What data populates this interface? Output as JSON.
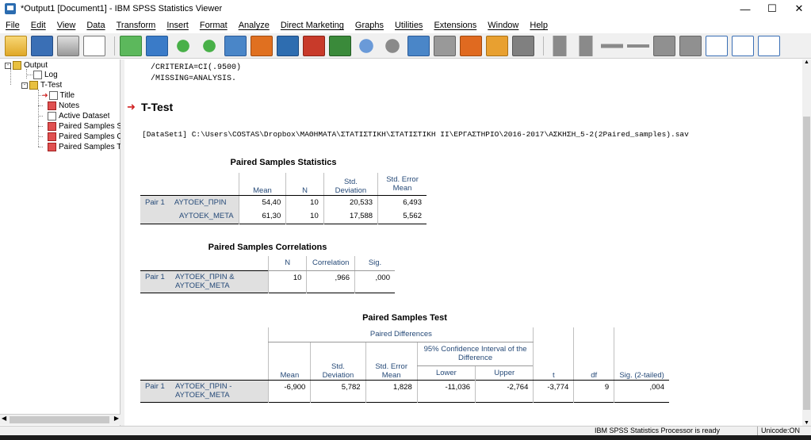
{
  "window": {
    "title": "*Output1 [Document1] - IBM SPSS Statistics Viewer",
    "minimize": "—",
    "maximize": "☐",
    "close": "✕"
  },
  "menu": [
    "File",
    "Edit",
    "View",
    "Data",
    "Transform",
    "Insert",
    "Format",
    "Analyze",
    "Direct Marketing",
    "Graphs",
    "Utilities",
    "Extensions",
    "Window",
    "Help"
  ],
  "toolbar": {
    "icons": [
      "open-icon",
      "save-icon",
      "print-icon",
      "print-preview-icon",
      "export-icon",
      "recall-dialog-icon",
      "undo-icon",
      "redo-icon",
      "goto-data-icon",
      "goto-case-icon",
      "variables-icon",
      "designate-window-icon",
      "insert-output-icon",
      "show-all-icon",
      "collapse-icon",
      "hide-icon",
      "insert-heading-icon",
      "insert-title-icon",
      "insert-text-icon",
      "export-chart-icon",
      "navigate-back-icon",
      "navigate-forward-icon",
      "expand-icon",
      "collapse-minus-icon",
      "promote-icon",
      "demote-icon",
      "show-output-icon",
      "copy-icon",
      "paste-icon"
    ]
  },
  "tree": {
    "output": "Output",
    "log": "Log",
    "ttest": "T-Test",
    "title": "Title",
    "notes": "Notes",
    "active_dataset": "Active Dataset",
    "pss": "Paired Samples S",
    "psc": "Paired Samples C",
    "pst": "Paired Samples T"
  },
  "viewer": {
    "syntax_line1": "/CRITERIA=CI(.9500)",
    "syntax_line2": "/MISSING=ANALYSIS.",
    "heading": "T-Test",
    "dataset": "[DataSet1] C:\\Users\\COSTAS\\Dropbox\\ΜΑΘΗΜΑΤΑ\\ΣΤΑΤΙΣΤΙΚΗ\\ΣΤΑΤΙΣΤΙΚΗ ΙΙ\\ΕΡΓΑΣΤΗΡΙΟ\\2016-2017\\ΑΣΚΗΣΗ_5-2(2Paired_samples).sav"
  },
  "stats": {
    "caption": "Paired Samples Statistics",
    "h_mean": "Mean",
    "h_n": "N",
    "h_sd": "Std. Deviation",
    "h_se": "Std. Error Mean",
    "pair": "Pair 1",
    "r1": {
      "label": "ΑΥΤΟΕΚ_ΠΡΙΝ",
      "mean": "54,40",
      "n": "10",
      "sd": "20,533",
      "se": "6,493"
    },
    "r2": {
      "label": "ΑΥΤΟΕΚ_ΜΕΤΑ",
      "mean": "61,30",
      "n": "10",
      "sd": "17,588",
      "se": "5,562"
    }
  },
  "corr": {
    "caption": "Paired Samples Correlations",
    "h_n": "N",
    "h_corr": "Correlation",
    "h_sig": "Sig.",
    "pair": "Pair 1",
    "label": "ΑΥΤΟΕΚ_ΠΡΙΝ & ΑΥΤΟΕΚ_ΜΕΤΑ",
    "n": "10",
    "corr": ",966",
    "sig": ",000"
  },
  "test": {
    "caption": "Paired Samples Test",
    "h_pd": "Paired Differences",
    "h_ci": "95% Confidence Interval of the Difference",
    "h_mean": "Mean",
    "h_sd": "Std. Deviation",
    "h_se": "Std. Error Mean",
    "h_lower": "Lower",
    "h_upper": "Upper",
    "h_t": "t",
    "h_df": "df",
    "h_sig": "Sig. (2-tailed)",
    "pair": "Pair 1",
    "label": "ΑΥΤΟΕΚ_ΠΡΙΝ - ΑΥΤΟΕΚ_ΜΕΤΑ",
    "mean": "-6,900",
    "sd": "5,782",
    "se": "1,828",
    "lower": "-11,036",
    "upper": "-2,764",
    "t": "-3,774",
    "df": "9",
    "sig": ",004"
  },
  "status": {
    "processor": "IBM SPSS Statistics Processor is ready",
    "unicode": "Unicode:ON"
  },
  "colors": {
    "accent": "#264a78",
    "shade": "#e0e0e0"
  }
}
